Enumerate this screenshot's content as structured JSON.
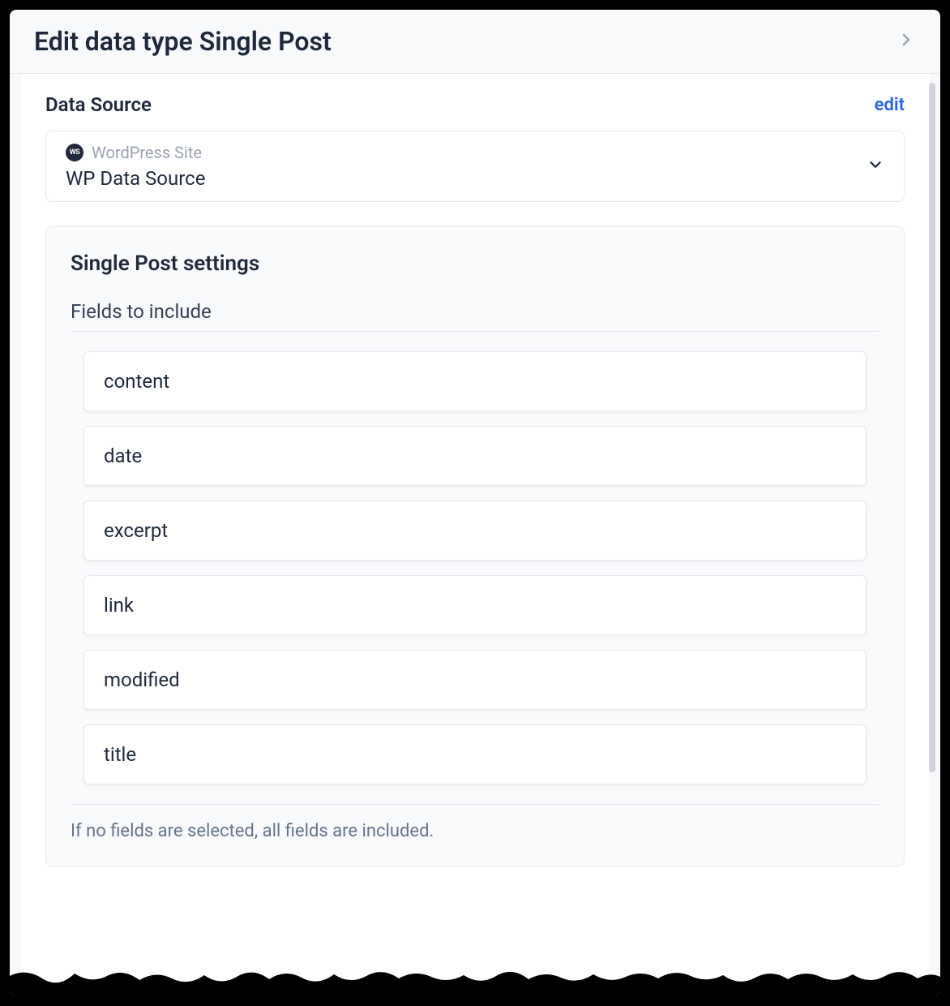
{
  "header": {
    "title": "Edit data type Single Post"
  },
  "data_source": {
    "section_label": "Data Source",
    "edit_label": "edit",
    "badge_text": "WS",
    "type_label": "WordPress Site",
    "value": "WP Data Source"
  },
  "settings": {
    "title": "Single Post settings",
    "fields_label": "Fields to include",
    "fields": [
      {
        "name": "content"
      },
      {
        "name": "date"
      },
      {
        "name": "excerpt"
      },
      {
        "name": "link"
      },
      {
        "name": "modified"
      },
      {
        "name": "title"
      }
    ],
    "hint": "If no fields are selected, all fields are included."
  }
}
